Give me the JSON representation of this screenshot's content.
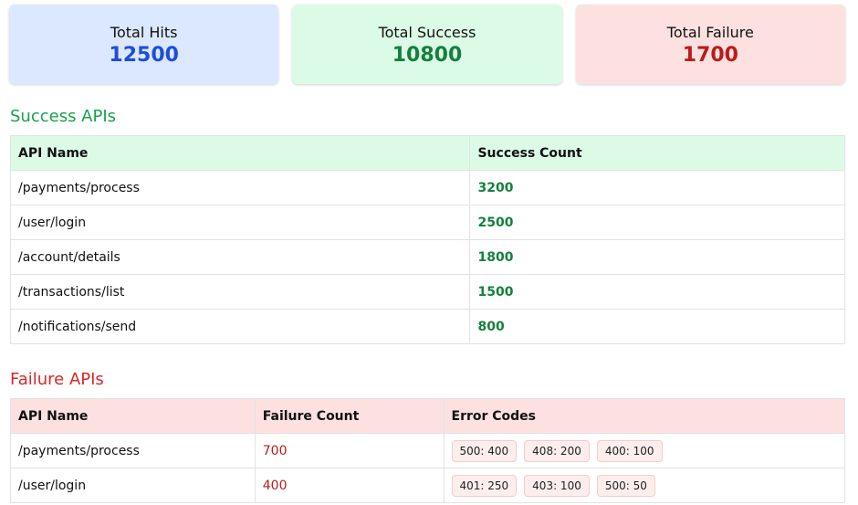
{
  "summary": {
    "hits": {
      "label": "Total Hits",
      "value": "12500"
    },
    "success": {
      "label": "Total Success",
      "value": "10800"
    },
    "failure": {
      "label": "Total Failure",
      "value": "1700"
    }
  },
  "success_section": {
    "title": "Success APIs",
    "headers": [
      "API Name",
      "Success Count"
    ],
    "rows": [
      {
        "api": "/payments/process",
        "count": "3200"
      },
      {
        "api": "/user/login",
        "count": "2500"
      },
      {
        "api": "/account/details",
        "count": "1800"
      },
      {
        "api": "/transactions/list",
        "count": "1500"
      },
      {
        "api": "/notifications/send",
        "count": "800"
      }
    ]
  },
  "failure_section": {
    "title": "Failure APIs",
    "headers": [
      "API Name",
      "Failure Count",
      "Error Codes"
    ],
    "rows": [
      {
        "api": "/payments/process",
        "count": "700",
        "codes": [
          "500: 400",
          "408: 200",
          "400: 100"
        ]
      },
      {
        "api": "/user/login",
        "count": "400",
        "codes": [
          "401: 250",
          "403: 100",
          "500: 50"
        ]
      }
    ]
  },
  "colors": {
    "success_accent": "#16a34a",
    "failure_accent": "#dc2626",
    "hits_accent": "#1d4ed8"
  }
}
